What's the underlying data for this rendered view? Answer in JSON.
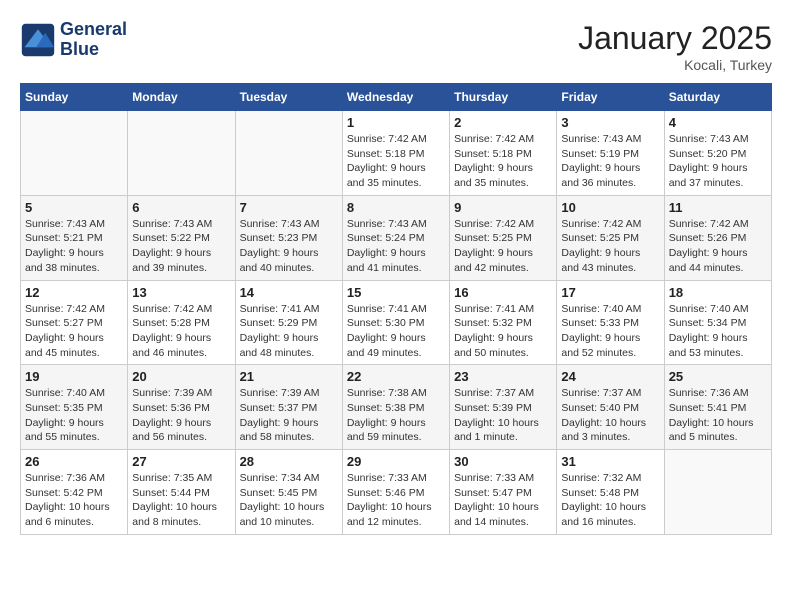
{
  "header": {
    "logo_line1": "General",
    "logo_line2": "Blue",
    "month": "January 2025",
    "location": "Kocali, Turkey"
  },
  "days_of_week": [
    "Sunday",
    "Monday",
    "Tuesday",
    "Wednesday",
    "Thursday",
    "Friday",
    "Saturday"
  ],
  "weeks": [
    [
      {
        "day": "",
        "info": ""
      },
      {
        "day": "",
        "info": ""
      },
      {
        "day": "",
        "info": ""
      },
      {
        "day": "1",
        "info": "Sunrise: 7:42 AM\nSunset: 5:18 PM\nDaylight: 9 hours\nand 35 minutes."
      },
      {
        "day": "2",
        "info": "Sunrise: 7:42 AM\nSunset: 5:18 PM\nDaylight: 9 hours\nand 35 minutes."
      },
      {
        "day": "3",
        "info": "Sunrise: 7:43 AM\nSunset: 5:19 PM\nDaylight: 9 hours\nand 36 minutes."
      },
      {
        "day": "4",
        "info": "Sunrise: 7:43 AM\nSunset: 5:20 PM\nDaylight: 9 hours\nand 37 minutes."
      }
    ],
    [
      {
        "day": "5",
        "info": "Sunrise: 7:43 AM\nSunset: 5:21 PM\nDaylight: 9 hours\nand 38 minutes."
      },
      {
        "day": "6",
        "info": "Sunrise: 7:43 AM\nSunset: 5:22 PM\nDaylight: 9 hours\nand 39 minutes."
      },
      {
        "day": "7",
        "info": "Sunrise: 7:43 AM\nSunset: 5:23 PM\nDaylight: 9 hours\nand 40 minutes."
      },
      {
        "day": "8",
        "info": "Sunrise: 7:43 AM\nSunset: 5:24 PM\nDaylight: 9 hours\nand 41 minutes."
      },
      {
        "day": "9",
        "info": "Sunrise: 7:42 AM\nSunset: 5:25 PM\nDaylight: 9 hours\nand 42 minutes."
      },
      {
        "day": "10",
        "info": "Sunrise: 7:42 AM\nSunset: 5:25 PM\nDaylight: 9 hours\nand 43 minutes."
      },
      {
        "day": "11",
        "info": "Sunrise: 7:42 AM\nSunset: 5:26 PM\nDaylight: 9 hours\nand 44 minutes."
      }
    ],
    [
      {
        "day": "12",
        "info": "Sunrise: 7:42 AM\nSunset: 5:27 PM\nDaylight: 9 hours\nand 45 minutes."
      },
      {
        "day": "13",
        "info": "Sunrise: 7:42 AM\nSunset: 5:28 PM\nDaylight: 9 hours\nand 46 minutes."
      },
      {
        "day": "14",
        "info": "Sunrise: 7:41 AM\nSunset: 5:29 PM\nDaylight: 9 hours\nand 48 minutes."
      },
      {
        "day": "15",
        "info": "Sunrise: 7:41 AM\nSunset: 5:30 PM\nDaylight: 9 hours\nand 49 minutes."
      },
      {
        "day": "16",
        "info": "Sunrise: 7:41 AM\nSunset: 5:32 PM\nDaylight: 9 hours\nand 50 minutes."
      },
      {
        "day": "17",
        "info": "Sunrise: 7:40 AM\nSunset: 5:33 PM\nDaylight: 9 hours\nand 52 minutes."
      },
      {
        "day": "18",
        "info": "Sunrise: 7:40 AM\nSunset: 5:34 PM\nDaylight: 9 hours\nand 53 minutes."
      }
    ],
    [
      {
        "day": "19",
        "info": "Sunrise: 7:40 AM\nSunset: 5:35 PM\nDaylight: 9 hours\nand 55 minutes."
      },
      {
        "day": "20",
        "info": "Sunrise: 7:39 AM\nSunset: 5:36 PM\nDaylight: 9 hours\nand 56 minutes."
      },
      {
        "day": "21",
        "info": "Sunrise: 7:39 AM\nSunset: 5:37 PM\nDaylight: 9 hours\nand 58 minutes."
      },
      {
        "day": "22",
        "info": "Sunrise: 7:38 AM\nSunset: 5:38 PM\nDaylight: 9 hours\nand 59 minutes."
      },
      {
        "day": "23",
        "info": "Sunrise: 7:37 AM\nSunset: 5:39 PM\nDaylight: 10 hours\nand 1 minute."
      },
      {
        "day": "24",
        "info": "Sunrise: 7:37 AM\nSunset: 5:40 PM\nDaylight: 10 hours\nand 3 minutes."
      },
      {
        "day": "25",
        "info": "Sunrise: 7:36 AM\nSunset: 5:41 PM\nDaylight: 10 hours\nand 5 minutes."
      }
    ],
    [
      {
        "day": "26",
        "info": "Sunrise: 7:36 AM\nSunset: 5:42 PM\nDaylight: 10 hours\nand 6 minutes."
      },
      {
        "day": "27",
        "info": "Sunrise: 7:35 AM\nSunset: 5:44 PM\nDaylight: 10 hours\nand 8 minutes."
      },
      {
        "day": "28",
        "info": "Sunrise: 7:34 AM\nSunset: 5:45 PM\nDaylight: 10 hours\nand 10 minutes."
      },
      {
        "day": "29",
        "info": "Sunrise: 7:33 AM\nSunset: 5:46 PM\nDaylight: 10 hours\nand 12 minutes."
      },
      {
        "day": "30",
        "info": "Sunrise: 7:33 AM\nSunset: 5:47 PM\nDaylight: 10 hours\nand 14 minutes."
      },
      {
        "day": "31",
        "info": "Sunrise: 7:32 AM\nSunset: 5:48 PM\nDaylight: 10 hours\nand 16 minutes."
      },
      {
        "day": "",
        "info": ""
      }
    ]
  ]
}
